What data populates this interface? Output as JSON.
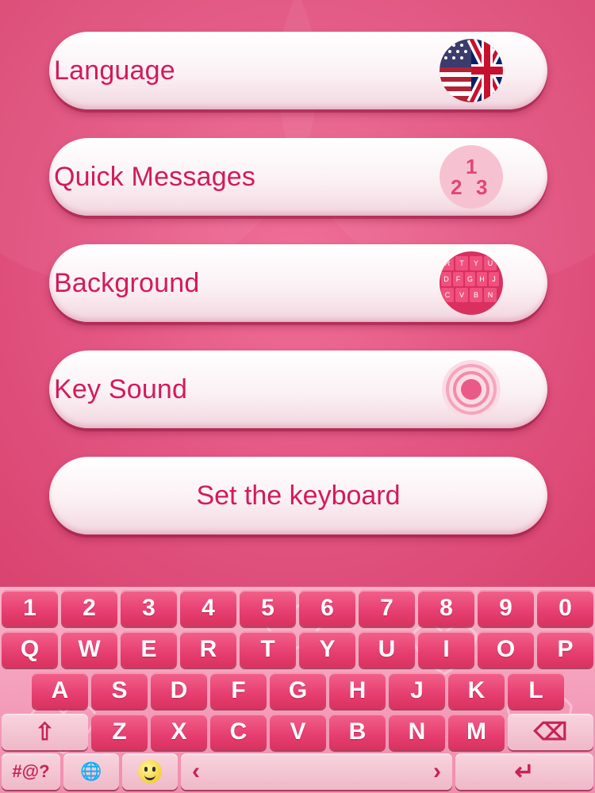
{
  "menu": {
    "language_label": "Language",
    "quick_messages_label": "Quick Messages",
    "background_label": "Background",
    "key_sound_label": "Key Sound",
    "set_keyboard_label": "Set the keyboard"
  },
  "icons": {
    "language": "us-uk-flag-icon",
    "quick_messages": "numbers-123-icon",
    "background": "keyboard-preview-icon",
    "key_sound": "sound-waves-icon",
    "quick_messages_digits": [
      "1",
      "2",
      "3"
    ],
    "background_preview_keys": [
      "R",
      "T",
      "Y",
      "U",
      "D",
      "F",
      "G",
      "H",
      "J",
      "C",
      "V",
      "B",
      "N"
    ]
  },
  "keyboard": {
    "numbers": [
      "1",
      "2",
      "3",
      "4",
      "5",
      "6",
      "7",
      "8",
      "9",
      "0"
    ],
    "row1": [
      "Q",
      "W",
      "E",
      "R",
      "T",
      "Y",
      "U",
      "I",
      "O",
      "P"
    ],
    "row2": [
      "A",
      "S",
      "D",
      "F",
      "G",
      "H",
      "J",
      "K",
      "L"
    ],
    "row3": [
      "Z",
      "X",
      "C",
      "V",
      "B",
      "N",
      "M"
    ],
    "symbols_label": "#@?",
    "shift_glyph": "⇧",
    "backspace_glyph": "⌫",
    "globe_glyph": "🌐",
    "enter_glyph": "↵",
    "space_left_glyph": "‹",
    "space_right_glyph": "›"
  },
  "colors": {
    "accent": "#d41a5a",
    "key": "#e63e70",
    "background": "#e24f7f"
  }
}
